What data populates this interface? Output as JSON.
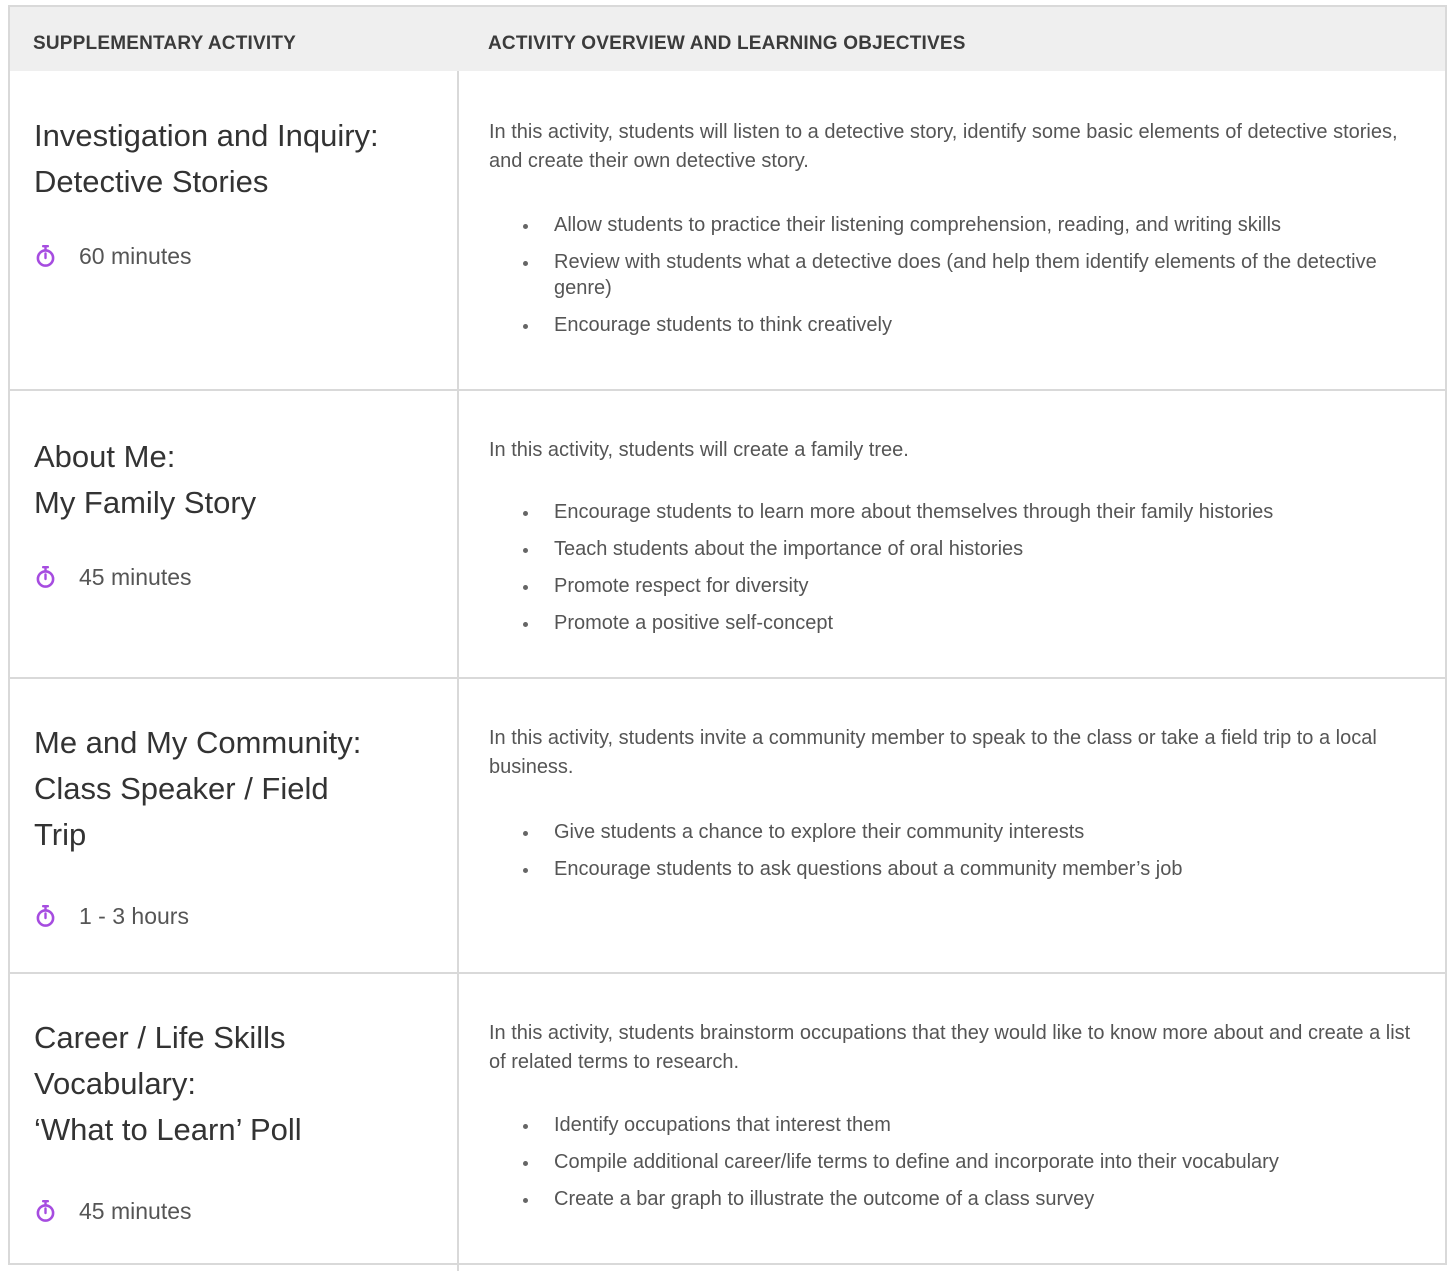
{
  "header": {
    "col1": "SUPPLEMENTARY ACTIVITY",
    "col2": "ACTIVITY OVERVIEW AND LEARNING OBJECTIVES"
  },
  "colors": {
    "accent": "#a64ce0",
    "header_bg": "#efefef",
    "border": "#d9d9d9"
  },
  "rows": [
    {
      "title": [
        "Investigation and Inquiry:",
        "Detective Stories"
      ],
      "duration": "60 minutes",
      "icon": "stopwatch-icon",
      "overview": "In this activity, students will listen to a detective story, identify some basic elements of detective stories, and create their own detective story.",
      "objectives": [
        "Allow students to practice their listening comprehension, reading, and writing skills",
        "Review with students what a detective does (and help them identify elements of the detective genre)",
        "Encourage students to think creatively"
      ]
    },
    {
      "title": [
        "About Me:",
        "My Family Story"
      ],
      "duration": "45 minutes",
      "icon": "stopwatch-icon",
      "overview": "In this activity, students will create a family tree.",
      "objectives": [
        "Encourage students to learn more about themselves through their family histories",
        "Teach students about the importance of oral histories",
        "Promote respect for diversity",
        "Promote a positive self-concept"
      ]
    },
    {
      "title": [
        "Me and My Community:",
        "Class Speaker / Field",
        "Trip"
      ],
      "duration": "1 - 3 hours",
      "icon": "stopwatch-icon",
      "overview": "In this activity, students invite a community member to speak to the class or take a field trip to a local business.",
      "objectives": [
        "Give students a chance to explore their community interests",
        "Encourage students to ask questions about a community member’s job"
      ]
    },
    {
      "title": [
        "Career / Life Skills",
        "Vocabulary:",
        "‘What to Learn’ Poll"
      ],
      "duration": "45 minutes",
      "icon": "stopwatch-icon",
      "overview": "In this activity, students brainstorm occupations that they would like to know more about and create a list of related terms to research.",
      "objectives": [
        "Identify occupations that interest them",
        "Compile additional career/life terms to define and incorporate into their vocabulary",
        "Create a bar graph to illustrate the outcome of a class survey"
      ]
    }
  ]
}
